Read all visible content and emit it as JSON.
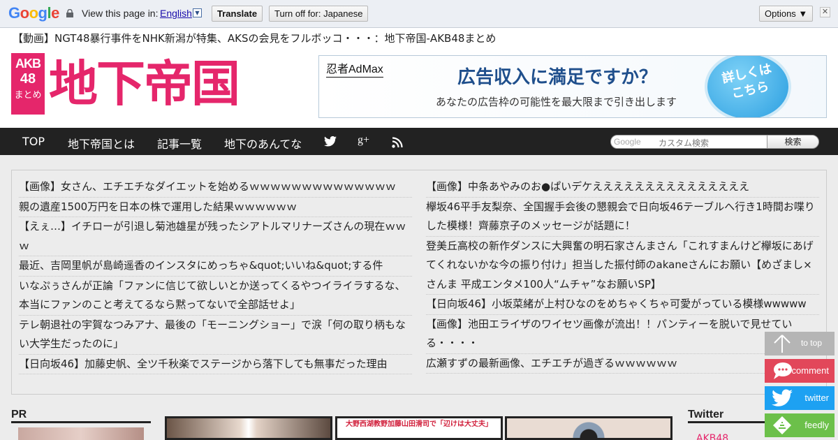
{
  "translate_bar": {
    "logo": "Google",
    "view_text": "View this page in:",
    "language": "English",
    "dropdown_arrow": "▼",
    "translate_label": "Translate",
    "turn_off_label": "Turn off for: Japanese",
    "options_label": "Options ▼",
    "close_label": "✕"
  },
  "page_title": "【動画】NGT48暴行事件をNHK新潟が特集、AKSの会見をフルボッコ・・・：地下帝国-AKB48まとめ",
  "logo": {
    "line1": "AKB",
    "line2": "48",
    "line3": "まとめ",
    "title": "地下帝国",
    "color": "#e5266b"
  },
  "ad": {
    "brand": "忍者AdMax",
    "headline": "広告収入に満足ですか？",
    "subline": "あなたの広告枠の可能性を最大限まで引き出します",
    "circle_text": "詳しくはこちら"
  },
  "nav": {
    "items": [
      "TOP",
      "地下帝国とは",
      "記事一覧",
      "地下のあんてな"
    ],
    "icons": [
      "twitter-icon",
      "google-plus-icon",
      "rss-icon"
    ],
    "google_plus_label": "g+"
  },
  "search": {
    "google_label": "Google",
    "placeholder": "カスタム検索",
    "button_label": "検索"
  },
  "articles": {
    "left": [
      "【画像】女さん、エチエチなダイエットを始めるｗｗｗｗｗｗｗｗｗｗｗｗｗｗ",
      "親の遺産1500万円を日本の株で運用した結果ｗｗｗｗｗｗ",
      "【えぇ…】イチローが引退し菊池雄星が残ったシアトルマリナーズさんの現在ｗｗｗ",
      "最近、吉岡里帆が島崎遥香のインスタにめっちゃ&quot;いいね&quot;する件",
      "いなぷぅさんが正論「ファンに信じて欲しいとか送ってくるやつイライラするな、本当にファンのこと考えてるなら黙ってないで全部話せよ」",
      "テレ朝退社の宇賀なつみアナ、最後の「モーニングショー」で涙「何の取り柄もない大学生だったのに」",
      "【日向坂46】加藤史帆、全ツ千秋楽でステージから落下しても無事だった理由"
    ],
    "right": [
      "【画像】中条あやみのお●ぱいデケえええええええええええええええ",
      "欅坂46平手友梨奈、全国握手会後の懇親会で日向坂46テーブルへ行き1時間お喋りした模様！齊藤京子のメッセージが話題に！",
      "登美丘高校の新作ダンスに大興奮の明石家さんまさん「これすまんけど欅坂にあげてくれないかな今の振り付け」担当した振付師のakaneさんにお願い【めざまし×さんま 平成エンタメ100人“ムチャ”なお願いSP】",
      "【日向坂46】小坂菜緒が上村ひなのをめちゃくちゃ可愛がっている模様wwwww",
      "【画像】池田エライザのワイセツ画像が流出！！パンティーを脱いで見せている・・・・",
      "広瀬すずの最新画像、エチエチが過ぎるｗｗｗｗｗｗ"
    ]
  },
  "pr_label": "PR",
  "thumb_caption": "大野西湖教野加藤山田滑司で「辺けは大丈夫」",
  "twitter_label": "Twitter",
  "twitter_embed_text": "AKB48",
  "side_buttons": {
    "top": "to top",
    "comment": "comment",
    "twitter": "twitter",
    "feedly": "feedly"
  }
}
